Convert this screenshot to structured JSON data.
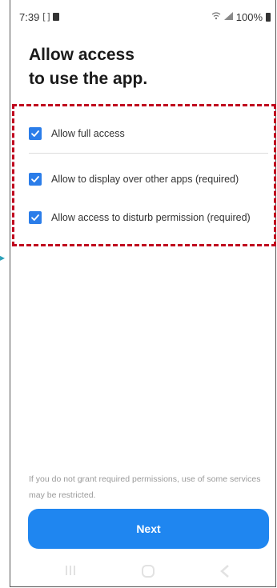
{
  "status_bar": {
    "time": "7:39",
    "left_icons": [
      "screen-icon",
      "sim-icon"
    ],
    "right_icons": [
      "wifi-icon",
      "signal-icon"
    ],
    "battery_text": "100%"
  },
  "title": {
    "line1": "Allow access",
    "line2": "to use the app."
  },
  "permissions": [
    {
      "label": "Allow full access",
      "checked": true
    },
    {
      "label": "Allow to display over other apps (required)",
      "checked": true
    },
    {
      "label": "Allow access to disturb permission (required)",
      "checked": true
    }
  ],
  "disclaimer": "If you do not grant required permissions, use of some services may be restricted.",
  "next_button": {
    "label": "Next"
  },
  "colors": {
    "accent": "#1f86f0",
    "checkbox": "#2b7de9",
    "highlight_border": "#c0001e"
  },
  "nav_bar": {
    "icons": [
      "recent-apps-icon",
      "home-icon",
      "back-icon"
    ]
  }
}
